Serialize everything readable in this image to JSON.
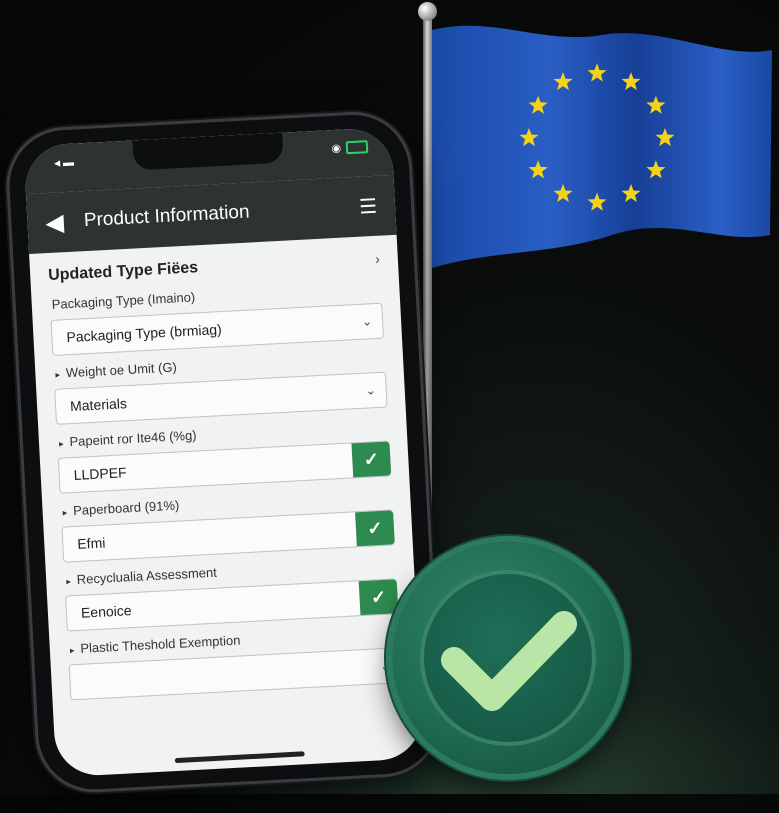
{
  "app": {
    "header_title": "Product Information",
    "section_title": "Updated Type Fiëes"
  },
  "fields": [
    {
      "label": "Packaging Type (Imaino)",
      "value": "Packaging Type (brmiag)",
      "control": "dropdown",
      "bullet": false
    },
    {
      "label": "Weight oe Umit (G)",
      "value": "Materials",
      "control": "dropdown",
      "bullet": true
    },
    {
      "label": "Papeint ror Ite46 (%g)",
      "value": "LLDPEF",
      "control": "checked",
      "bullet": true
    },
    {
      "label": "Paperboard (91%)",
      "value": "Efmi",
      "control": "checked",
      "bullet": true
    },
    {
      "label": "Recyclualia Assessment",
      "value": "Eenoice",
      "control": "checked",
      "bullet": true
    },
    {
      "label": "Plastic Theshold Exemption",
      "value": "",
      "control": "dropdown",
      "bullet": true
    }
  ],
  "icons": {
    "back": "back-arrow-icon",
    "menu": "menu-icon",
    "chevron_right": "chevron-right-icon",
    "chevron_down": "chevron-down-icon",
    "check": "check-icon",
    "flag": "eu-flag-icon",
    "badge": "checkmark-badge-icon"
  },
  "colors": {
    "header_bg": "#2c3331",
    "check_green": "#2e8b4f",
    "badge_green": "#1e6a52",
    "flag_blue": "#1f4fb0",
    "star_yellow": "#f5d21a"
  }
}
